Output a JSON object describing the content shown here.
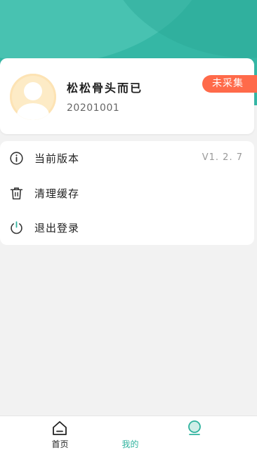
{
  "profile": {
    "name": "松松骨头而已",
    "id": "20201001",
    "status_badge": "未采集"
  },
  "menu": {
    "items": [
      {
        "label": "当前版本",
        "value": "V1. 2. 7",
        "icon": "info-icon"
      },
      {
        "label": "清理缓存",
        "icon": "trash-icon"
      },
      {
        "label": "退出登录",
        "icon": "power-icon"
      }
    ]
  },
  "tabbar": {
    "tabs": [
      {
        "label": "首页",
        "icon": "home-icon",
        "active": false
      },
      {
        "label": "我的",
        "icon": "user-icon",
        "active": true
      }
    ]
  },
  "colors": {
    "accent": "#35b7a5",
    "badge": "#ff6a4a",
    "active_tab": "#2fb39e"
  }
}
